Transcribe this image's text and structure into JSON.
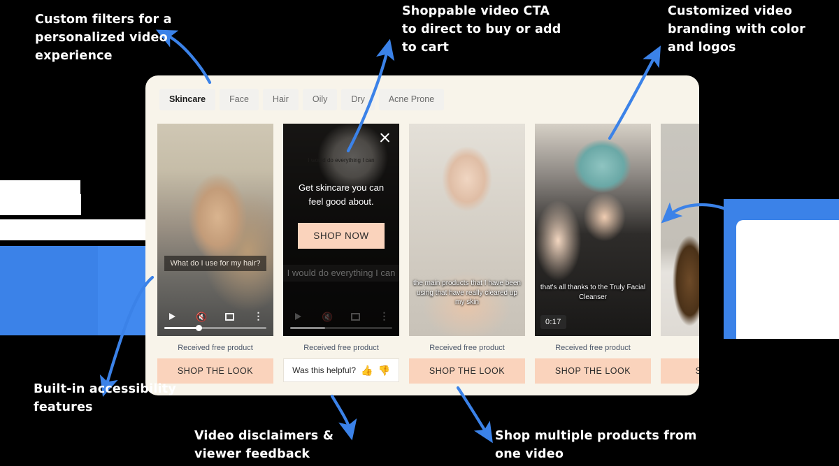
{
  "annotations": [
    {
      "id": "custom-filters",
      "text": "Custom filters for a personalized video experience"
    },
    {
      "id": "shoppable-cta",
      "text": "Shoppable video CTA to direct to buy or add to cart"
    },
    {
      "id": "custom-branding",
      "text": "Customized video branding with color and logos"
    },
    {
      "id": "accessibility",
      "text": "Built-in accessibility features"
    },
    {
      "id": "disclaimers",
      "text": "Video disclaimers & viewer feedback"
    },
    {
      "id": "multi-product",
      "text": "Shop multiple products from one video"
    }
  ],
  "widget": {
    "filters": [
      {
        "label": "Skincare",
        "active": true
      },
      {
        "label": "Face",
        "active": false
      },
      {
        "label": "Hair",
        "active": false
      },
      {
        "label": "Oily",
        "active": false
      },
      {
        "label": "Dry",
        "active": false
      },
      {
        "label": "Acne Prone",
        "active": false
      }
    ],
    "cards": [
      {
        "caption": "What do I use for my hair?",
        "disclaimer": "Received free product",
        "action_label": "SHOP THE LOOK",
        "action_type": "shop"
      },
      {
        "overlay_headline": "Get skincare you can feel good about.",
        "overlay_button": "SHOP NOW",
        "caption": "I would do everything I can",
        "caption_small": "I would do everything I can",
        "disclaimer": "Received free product",
        "action_label": "Was this helpful?",
        "action_type": "feedback",
        "thumb_up": "👍",
        "thumb_down": "👎",
        "close_label": "Close"
      },
      {
        "caption": "the main products that I have been using that have really cleared up my skin",
        "disclaimer": "Received free product",
        "action_label": "SHOP THE LOOK",
        "action_type": "shop"
      },
      {
        "caption": "that's all thanks to the Truly Facial Cleanser",
        "duration": "0:17",
        "disclaimer": "Received free product",
        "action_label": "SHOP THE LOOK",
        "action_type": "shop"
      },
      {
        "caption": "",
        "disclaimer": "",
        "action_label": "SH",
        "action_type": "shop"
      }
    ],
    "player": {
      "play_icon": "play-icon",
      "mute_icon": "mute-icon",
      "fullscreen_icon": "fullscreen-icon",
      "more_icon": "more-options-icon",
      "mute_glyph": "🔇",
      "more_glyph": "⋮"
    }
  },
  "colors": {
    "panel": "#f8f4ea",
    "accent_peach": "#fad3bc",
    "arrow_blue": "#3b82e8",
    "background": "#000000"
  }
}
